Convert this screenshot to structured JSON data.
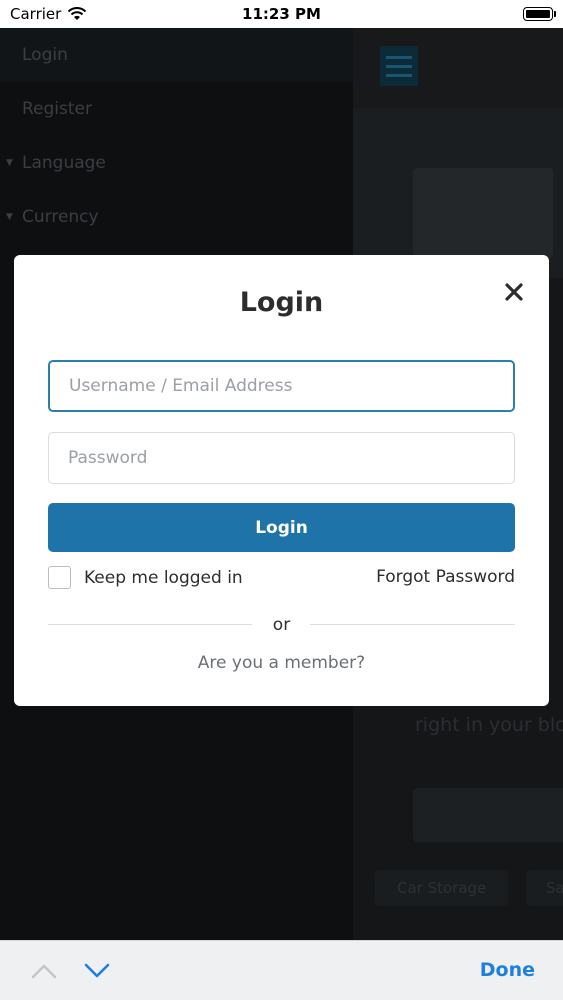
{
  "status_bar": {
    "carrier": "Carrier",
    "time": "11:23 PM"
  },
  "side_menu": {
    "items": [
      {
        "label": "Login"
      },
      {
        "label": "Register"
      },
      {
        "label": "Language"
      },
      {
        "label": "Currency"
      }
    ]
  },
  "background_page": {
    "hero_text": "right in your blo",
    "pills": [
      "Car Storage",
      "Sa"
    ]
  },
  "modal": {
    "title": "Login",
    "username_placeholder": "Username / Email Address",
    "password_placeholder": "Password",
    "login_button": "Login",
    "remember_label": "Keep me logged in",
    "forgot_password": "Forgot Password",
    "divider_text": "or",
    "member_link": "Are you a member?"
  },
  "keyboard_accessory": {
    "done_label": "Done"
  },
  "colors": {
    "accent": "#1e73a8",
    "focus_border": "#2c7fa6",
    "done_blue": "#1e7fe0"
  }
}
